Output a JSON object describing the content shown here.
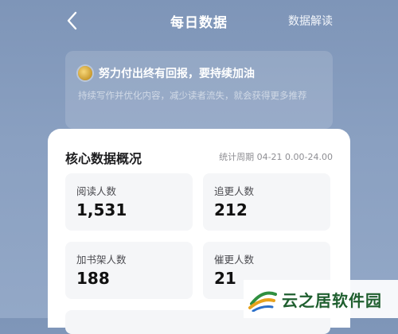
{
  "header": {
    "title": "每日数据",
    "right_link": "数据解读"
  },
  "banner": {
    "title": "努力付出终有回报，要持续加油",
    "subtitle": "持续写作并优化内容，减少读者流失，就会获得更多推荐"
  },
  "overview": {
    "title": "核心数据概况",
    "period": "统计周期 04-21 0.00-24.00",
    "metrics": [
      {
        "label": "阅读人数",
        "value": "1,531"
      },
      {
        "label": "追更人数",
        "value": "212"
      },
      {
        "label": "加书架人数",
        "value": "188"
      },
      {
        "label": "催更人数",
        "value": "21"
      }
    ]
  },
  "watermark": {
    "text": "云之居软件园"
  },
  "colors": {
    "header_bg": "#7e95b8",
    "card_bg": "#ffffff",
    "tile_bg": "#f5f6f8"
  }
}
